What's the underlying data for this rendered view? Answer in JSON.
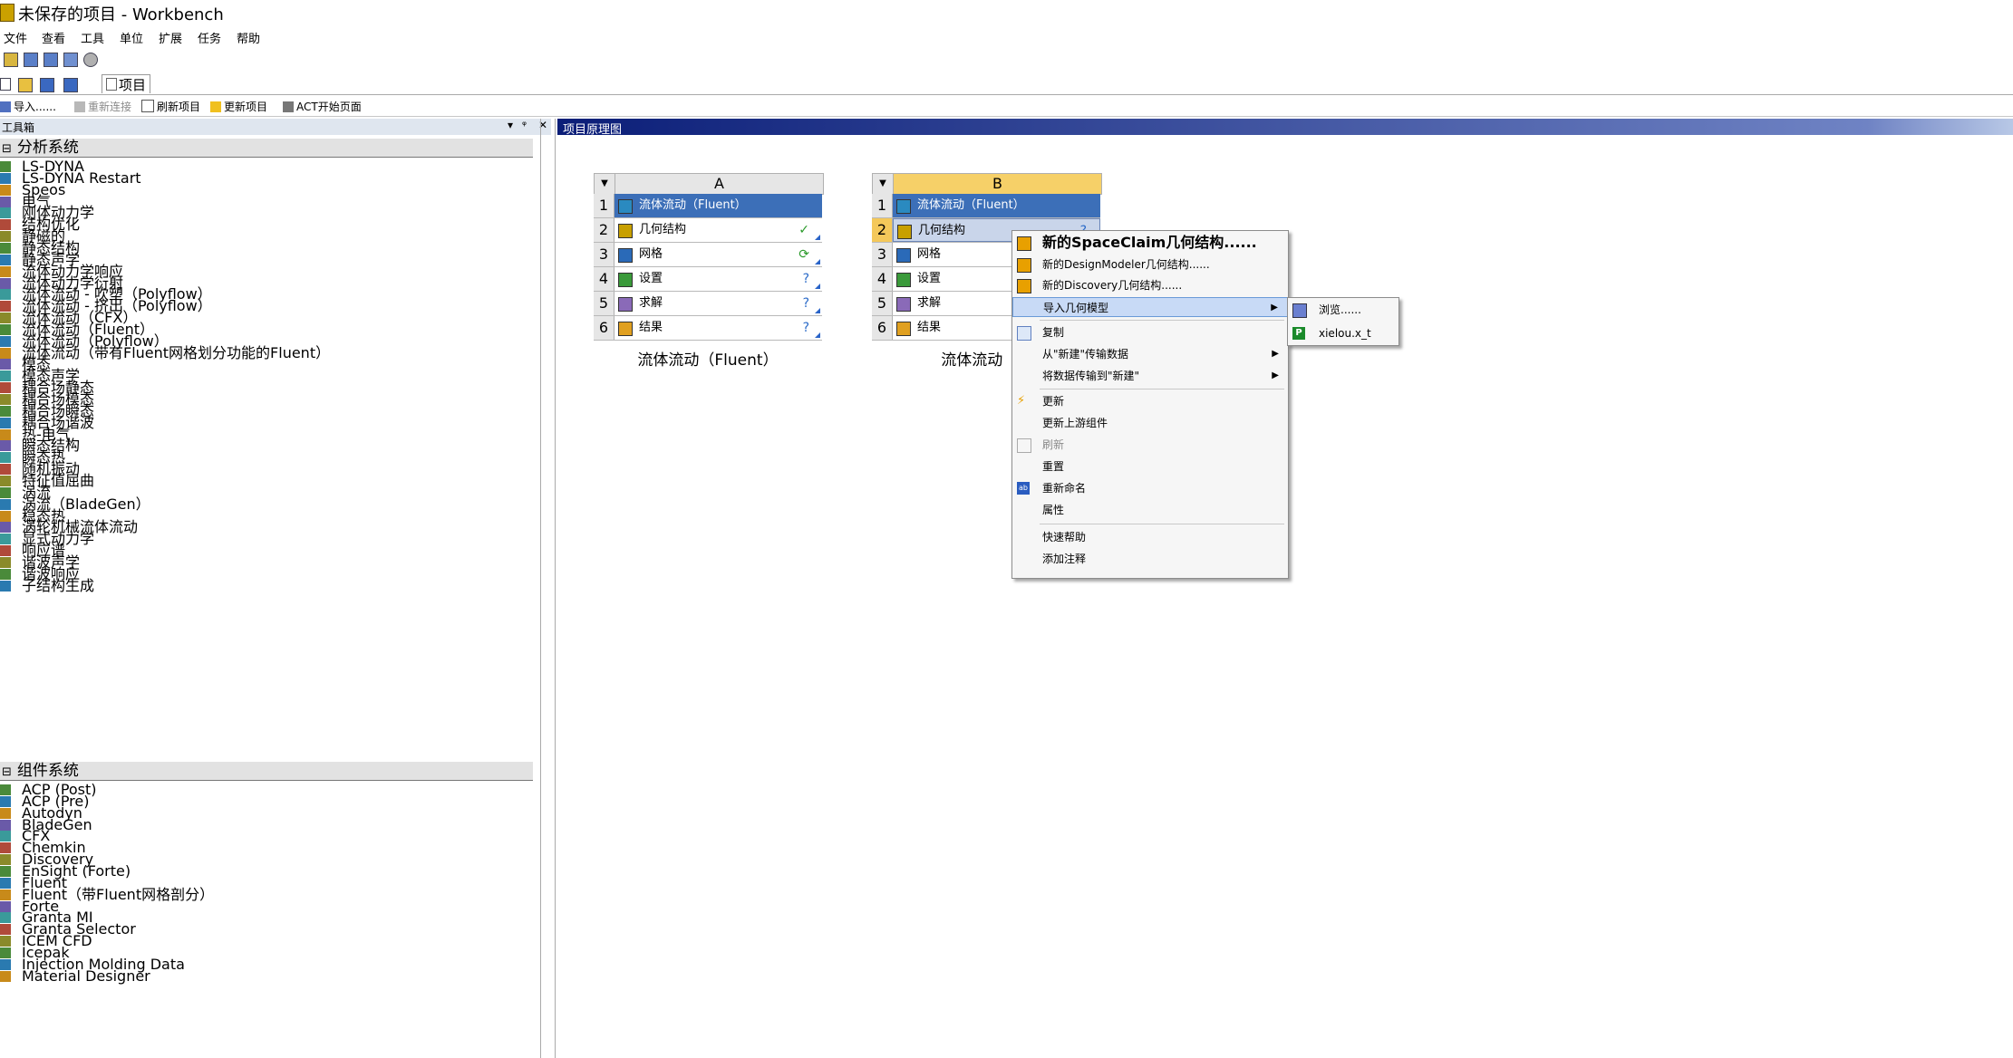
{
  "window": {
    "title": "未保存的项目 - Workbench"
  },
  "menubar": [
    "文件",
    "查看",
    "工具",
    "单位",
    "扩展",
    "任务",
    "帮助"
  ],
  "tabs": {
    "project": "项目"
  },
  "project_toolbar": {
    "import": "导入......",
    "reconnect": "重新连接",
    "refresh": "刷新项目",
    "update": "更新项目",
    "act_start": "ACT开始页面"
  },
  "toolbox": {
    "title": "工具箱",
    "pin": "▾ ᵠ ✕",
    "analysis_group": "分析系统",
    "analysis_items": [
      "LS-DYNA",
      "LS-DYNA Restart",
      "Speos",
      "电气",
      "刚体动力学",
      "结构优化",
      "静磁的",
      "静态结构",
      "静态声学",
      "流体动力学响应",
      "流体动力学衍射",
      "流体流动 - 吹塑（Polyflow）",
      "流体流动 - 挤出（Polyflow）",
      "流体流动（CFX）",
      "流体流动（Fluent）",
      "流体流动（Polyflow）",
      "流体流动（带有Fluent网格划分功能的Fluent）",
      "模态",
      "模态声学",
      "耦合场静态",
      "耦合场模态",
      "耦合场瞬态",
      "耦合场谐波",
      "热-电气",
      "瞬态结构",
      "瞬态热",
      "随机振动",
      "特征值屈曲",
      "涡流",
      "涡流（BladeGen）",
      "稳态热",
      "涡轮机械流体流动",
      "显式动力学",
      "响应谱",
      "谐波声学",
      "谐波响应",
      "子结构生成"
    ],
    "component_group": "组件系统",
    "component_items": [
      "ACP (Post)",
      "ACP (Pre)",
      "Autodyn",
      "BladeGen",
      "CFX",
      "Chemkin",
      "Discovery",
      "EnSight (Forte)",
      "Fluent",
      "Fluent（带Fluent网格剖分）",
      "Forte",
      "Granta MI",
      "Granta Selector",
      "ICEM CFD",
      "Icepak",
      "Injection Molding Data",
      "Material Designer"
    ]
  },
  "schematic": {
    "title": "项目原理图",
    "systems": [
      {
        "col": "A",
        "caption": "流体流动（Fluent）",
        "rows": [
          {
            "n": "1",
            "label": "流体流动（Fluent）",
            "status": ""
          },
          {
            "n": "2",
            "label": "几何结构",
            "status": "✓"
          },
          {
            "n": "3",
            "label": "网格",
            "status": "⟳"
          },
          {
            "n": "4",
            "label": "设置",
            "status": "?"
          },
          {
            "n": "5",
            "label": "求解",
            "status": "?"
          },
          {
            "n": "6",
            "label": "结果",
            "status": "?"
          }
        ]
      },
      {
        "col": "B",
        "caption": "流体流动（Fl",
        "rows": [
          {
            "n": "1",
            "label": "流体流动（Fluent）",
            "status": ""
          },
          {
            "n": "2",
            "label": "几何结构",
            "status": "?"
          },
          {
            "n": "3",
            "label": "网格",
            "status": ""
          },
          {
            "n": "4",
            "label": "设置",
            "status": ""
          },
          {
            "n": "5",
            "label": "求解",
            "status": ""
          },
          {
            "n": "6",
            "label": "结果",
            "status": ""
          }
        ]
      }
    ]
  },
  "context_menu": {
    "new_spaceclaim": "新的SpaceClaim几何结构......",
    "new_designmodeler": "新的DesignModeler几何结构......",
    "new_discovery": "新的Discovery几何结构......",
    "import_geometry": "导入几何模型",
    "copy": "复制",
    "transfer_from_new": "从\"新建\"传输数据",
    "transfer_to_new": "将数据传输到\"新建\"",
    "update": "更新",
    "update_upstream": "更新上游组件",
    "refresh": "刷新",
    "reset": "重置",
    "rename": "重新命名",
    "properties": "属性",
    "quick_help": "快速帮助",
    "add_note": "添加注释"
  },
  "submenu": {
    "browse": "浏览......",
    "recent_file": "xielou.x_t"
  }
}
